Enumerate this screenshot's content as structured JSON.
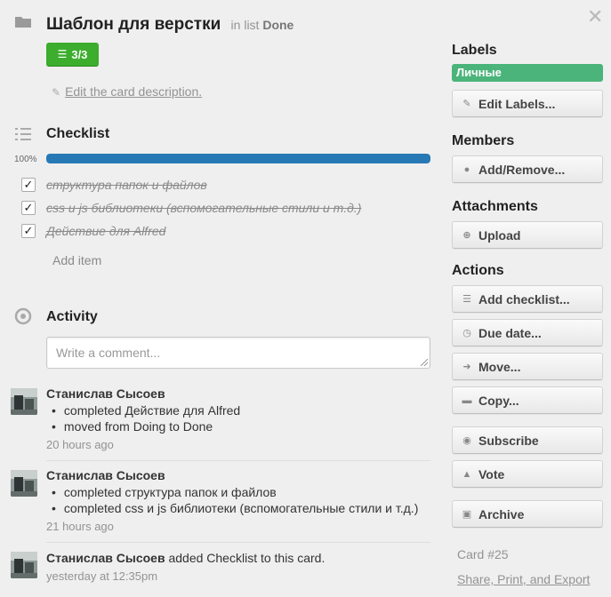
{
  "card": {
    "title": "Шаблон для верстки",
    "list_prefix": "in list",
    "list_name": "Done",
    "badge": "3/3",
    "edit_description": "Edit the card description."
  },
  "checklist": {
    "title": "Checklist",
    "percent_label": "100%",
    "progress": 1.0,
    "items": [
      {
        "text": "структура папок и файлов",
        "checked": true
      },
      {
        "text": "css и js библиотеки (вспомогательные стили и т.д.)",
        "checked": true
      },
      {
        "text": "Действие для Alfred",
        "checked": true
      }
    ],
    "add_item": "Add item"
  },
  "activity": {
    "title": "Activity",
    "comment_placeholder": "Write a comment...",
    "entries": [
      {
        "author": "Станислав Сысоев",
        "items": [
          "completed Действие для Alfred",
          "moved from Doing to Done"
        ],
        "time": "20 hours ago"
      },
      {
        "author": "Станислав Сысоев",
        "items": [
          "completed структура папок и файлов",
          "completed css и js библиотеки (вспомогательные стили и т.д.)"
        ],
        "time": "21 hours ago"
      },
      {
        "author": "Станислав Сысоев",
        "text": "added Checklist to this card.",
        "time": "yesterday at 12:35pm"
      }
    ]
  },
  "sidebar": {
    "labels_title": "Labels",
    "label_chip": "Личные",
    "label_color": "#4bb47a",
    "edit_labels": "Edit Labels...",
    "members_title": "Members",
    "add_remove": "Add/Remove...",
    "attachments_title": "Attachments",
    "upload": "Upload",
    "actions_title": "Actions",
    "add_checklist": "Add checklist...",
    "due_date": "Due date...",
    "move": "Move...",
    "copy": "Copy...",
    "subscribe": "Subscribe",
    "vote": "Vote",
    "archive": "Archive",
    "card_number": "Card #25",
    "share_link": "Share, Print, and Export"
  },
  "colors": {
    "badge_green": "#3cad2d",
    "progress_blue": "#2779b6"
  }
}
